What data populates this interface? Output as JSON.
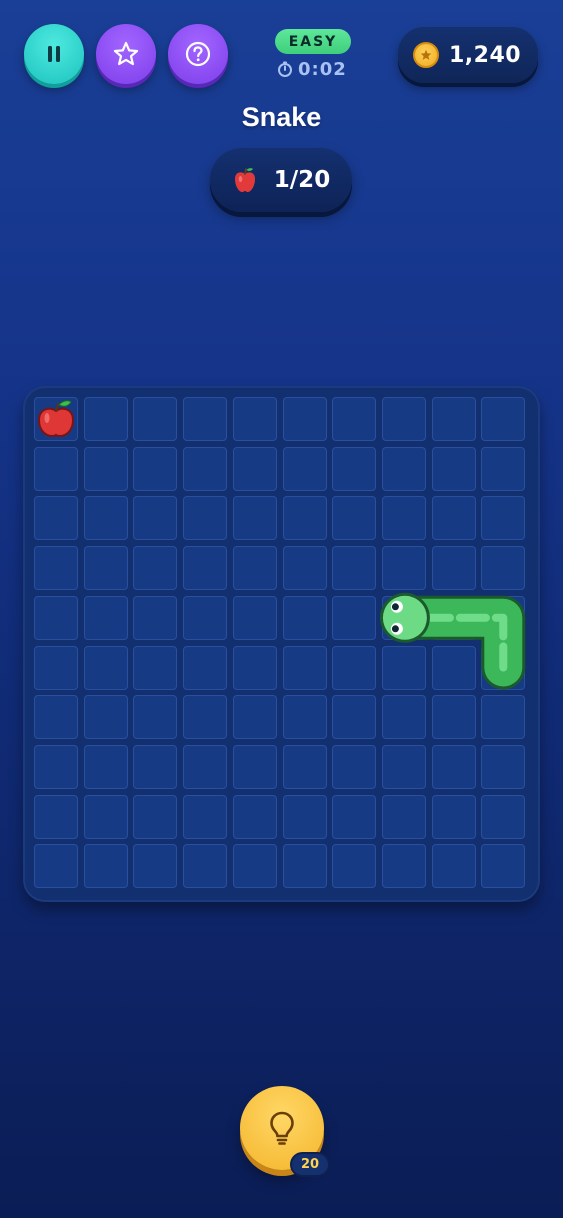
{
  "header": {
    "pause_icon": "pause-icon",
    "star_icon": "star-icon",
    "help_icon": "question-icon",
    "difficulty": "EASY",
    "timer": "0:02",
    "coins": "1,240"
  },
  "game": {
    "title": "Snake",
    "progress": "1/20",
    "grid_cols": 10,
    "grid_rows": 10,
    "apple_cell": [
      0,
      0
    ],
    "snake_cells": [
      [
        7,
        4
      ],
      [
        8,
        4
      ],
      [
        9,
        4
      ],
      [
        9,
        5
      ]
    ]
  },
  "hint": {
    "icon": "lightbulb-icon",
    "count": "20"
  },
  "colors": {
    "accent_teal": "#2fd6cf",
    "accent_purple": "#8b4cf5",
    "easy_green": "#4ddb8a",
    "snake_green": "#3cb85a",
    "hint_gold": "#f7bd35"
  }
}
